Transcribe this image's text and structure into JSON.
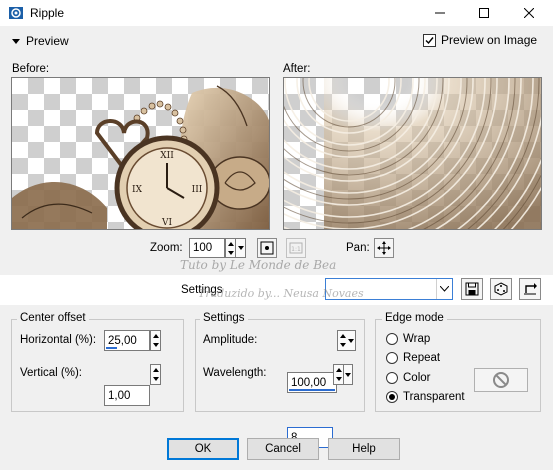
{
  "window": {
    "title": "Ripple",
    "accent": "#0078d7"
  },
  "preview": {
    "toggle_label": "Preview",
    "preview_on_image_label": "Preview on Image",
    "preview_on_image_checked": true,
    "before_label": "Before:",
    "after_label": "After:"
  },
  "zoom": {
    "label": "Zoom:",
    "value": "100",
    "pan_label": "Pan:"
  },
  "settings_bar": {
    "label": "Settings",
    "selected_preset": ""
  },
  "watermark": {
    "line1": "Tuto by Le Monde de Bea",
    "line2": "Traduzido by... Neusa Novaes"
  },
  "center_offset": {
    "title": "Center offset",
    "horizontal_label": "Horizontal (%):",
    "horizontal_value": "25,00",
    "horizontal_level": 0.25,
    "vertical_label": "Vertical (%):",
    "vertical_value": "1,00"
  },
  "settings": {
    "title": "Settings",
    "amplitude_label": "Amplitude:",
    "amplitude_value": "100,00",
    "amplitude_level": 1.0,
    "wavelength_label": "Wavelength:",
    "wavelength_value": "8",
    "wavelength_level": 0.08
  },
  "edge_mode": {
    "title": "Edge mode",
    "options": [
      "Wrap",
      "Repeat",
      "Color",
      "Transparent"
    ],
    "selected": "Transparent"
  },
  "buttons": {
    "ok": "OK",
    "cancel": "Cancel",
    "help": "Help"
  }
}
